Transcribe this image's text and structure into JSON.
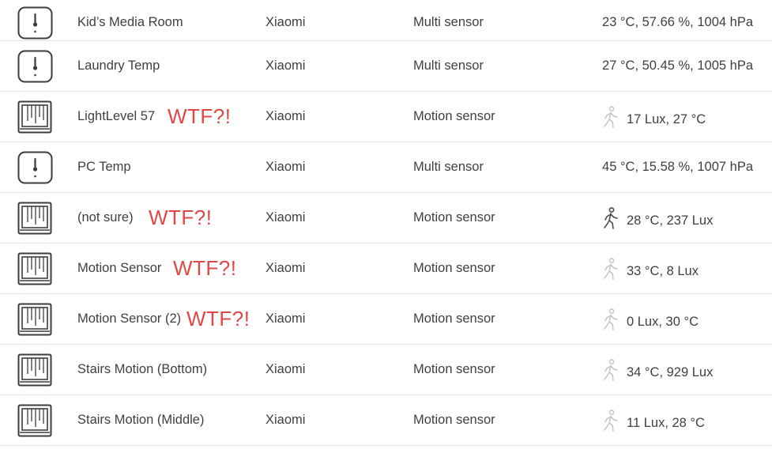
{
  "colors": {
    "text": "#3f3f3f",
    "annotation": "#e04848",
    "divider": "#e3e3e3",
    "icon_stroke": "#3c3c3c",
    "motion_active": "#4a4a4a",
    "motion_inactive": "#c8c8c8"
  },
  "devices": [
    {
      "name": "Kid’s Media Room",
      "manufacturer": "Xiaomi",
      "type": "Multi sensor",
      "state": "23 °C, 57.66 %, 1004 hPa",
      "icon": "thermometer-sensor-icon"
    },
    {
      "name": "Laundry Temp",
      "manufacturer": "Xiaomi",
      "type": "Multi sensor",
      "state": "27 °C, 50.45 %, 1005 hPa",
      "icon": "thermometer-sensor-icon"
    },
    {
      "name": "LightLevel 57",
      "manufacturer": "Xiaomi",
      "type": "Motion sensor",
      "state": "17 Lux, 27 °C",
      "icon": "motion-sensor-icon",
      "motion_icon": "walking-person-icon",
      "motion_active": false,
      "annotation": "WTF?!"
    },
    {
      "name": "PC Temp",
      "manufacturer": "Xiaomi",
      "type": "Multi sensor",
      "state": "45 °C, 15.58 %, 1007 hPa",
      "icon": "thermometer-sensor-icon"
    },
    {
      "name": "(not sure)",
      "manufacturer": "Xiaomi",
      "type": "Motion sensor",
      "state": "28 °C, 237 Lux",
      "icon": "motion-sensor-icon",
      "motion_icon": "walking-person-icon",
      "motion_active": true,
      "annotation": "WTF?!"
    },
    {
      "name": "Motion Sensor",
      "manufacturer": "Xiaomi",
      "type": "Motion sensor",
      "state": "33 °C, 8 Lux",
      "icon": "motion-sensor-icon",
      "motion_icon": "walking-person-icon",
      "motion_active": false,
      "annotation": "WTF?!"
    },
    {
      "name": "Motion Sensor (2)",
      "manufacturer": "Xiaomi",
      "type": "Motion sensor",
      "state": "0 Lux, 30 °C",
      "icon": "motion-sensor-icon",
      "motion_icon": "walking-person-icon",
      "motion_active": false,
      "annotation": "WTF?!"
    },
    {
      "name": "Stairs Motion (Bottom)",
      "manufacturer": "Xiaomi",
      "type": "Motion sensor",
      "state": "34 °C, 929 Lux",
      "icon": "motion-sensor-icon",
      "motion_icon": "walking-person-icon",
      "motion_active": false
    },
    {
      "name": "Stairs Motion (Middle)",
      "manufacturer": "Xiaomi",
      "type": "Motion sensor",
      "state": "11 Lux, 28 °C",
      "icon": "motion-sensor-icon",
      "motion_icon": "walking-person-icon",
      "motion_active": false
    }
  ]
}
